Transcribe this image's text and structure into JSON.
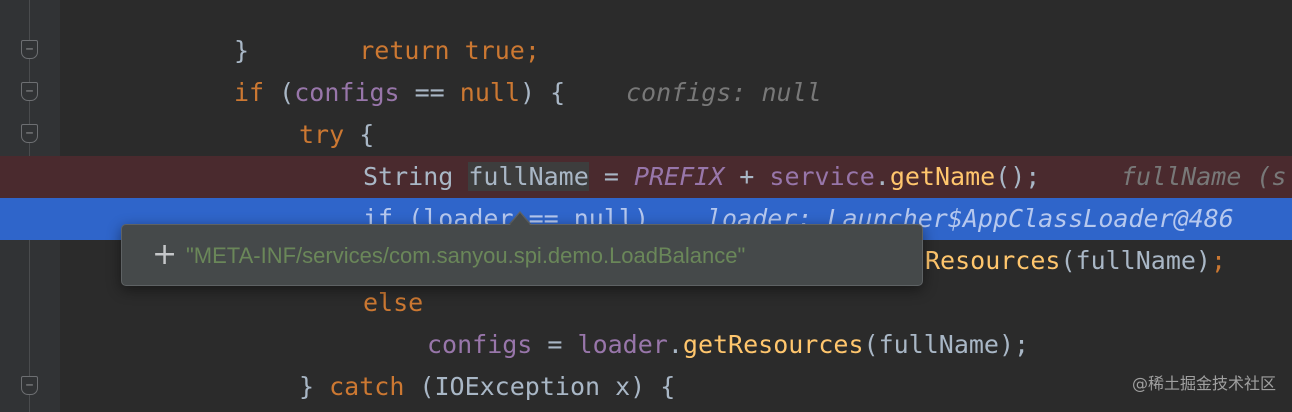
{
  "code": {
    "line1": {
      "kw": "return",
      "val": "true",
      "semi": ";"
    },
    "line2": {
      "brace": "}"
    },
    "line3": {
      "kw": "if",
      "open": " (",
      "var": "configs",
      "op": " == ",
      "nul": "null",
      "close": ") {",
      "hint": "configs: null"
    },
    "line4": {
      "kw": "try",
      "brace": " {"
    },
    "line5": {
      "type": "String ",
      "var": "fullName",
      "eq": " = ",
      "const": "PREFIX",
      "plus": " + ",
      "fld": "service",
      "dot": ".",
      "fn": "getName",
      "call": "();",
      "hint": "fullName (s"
    },
    "line6": {
      "kw": "if",
      "open": " (",
      "var": "loader",
      "op": " == ",
      "nul": "null",
      "close": ")",
      "hint": "loader: Launcher$AppClassLoader@486"
    },
    "line7": {
      "fn": "Resources",
      "args": "(fullName)",
      "semi": ";"
    },
    "line8": {
      "kw": "else"
    },
    "line9": {
      "fld": "configs",
      "eq": " = ",
      "fld2": "loader",
      "dot": ".",
      "fn": "getResources",
      "args": "(fullName);"
    },
    "line10": {
      "brace": "} ",
      "kw": "catch",
      "rest": " (IOException x) {"
    }
  },
  "tooltip": {
    "expand_symbol": "+",
    "value": "\"META-INF/services/com.sanyou.spi.demo.LoadBalance\""
  },
  "gutter": {
    "fold_symbol": "−"
  },
  "watermark": "@稀土掘金技术社区",
  "colors": {
    "editor_bg": "#2b2b2b",
    "keyword": "#cc7832",
    "field": "#9876aa",
    "method": "#ffc66d",
    "string": "#6a8759",
    "breakpoint_line": "#4a2a2e",
    "execution_line": "#2f65ca"
  }
}
